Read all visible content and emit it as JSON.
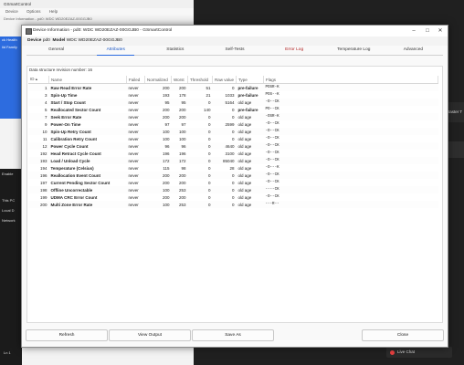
{
  "bg": {
    "title": "GSmartControl",
    "menu": [
      "Device",
      "Options",
      "Help"
    ],
    "sub1": "Device Information - pd0: WDC WD20EZAZ-00GGJB0",
    "sidebar": [
      "ck Health",
      "ild Family"
    ],
    "dark_items": [
      "Enable",
      "This PC",
      "Local D",
      "Network"
    ],
    "line": "Ln 1",
    "right_label": "Raster T",
    "live_chat": "Live Chat"
  },
  "dialog": {
    "title": "Device Information - pd0: WDC WD20EZAZ-00GGJB0 - GSmartControl",
    "device_label": "Device",
    "device_value": "pd0",
    "model_label": "Model",
    "model_value": "WDC WD20EZAZ-00GGJB0",
    "tabs": [
      {
        "label": "General"
      },
      {
        "label": "Attributes"
      },
      {
        "label": "Statistics"
      },
      {
        "label": "Self-Tests"
      },
      {
        "label": "Error Log"
      },
      {
        "label": "Temperature Log"
      },
      {
        "label": "Advanced"
      }
    ],
    "revision_text": "Data structure revision number: 16",
    "columns": [
      "ID",
      "Name",
      "Failed",
      "Normalized",
      "Worst",
      "Threshold",
      "Raw value",
      "Type",
      "Flags"
    ],
    "rows": [
      {
        "id": "1",
        "name": "Raw Read Error Rate",
        "failed": "never",
        "norm": "200",
        "worst": "200",
        "thr": "51",
        "raw": "0",
        "type": "pre-failure",
        "flags": "POSR-K"
      },
      {
        "id": "3",
        "name": "Spin-Up Time",
        "failed": "never",
        "norm": "193",
        "worst": "178",
        "thr": "21",
        "raw": "1033",
        "type": "pre-failure",
        "flags": "POS--K"
      },
      {
        "id": "4",
        "name": "Start / Stop Count",
        "failed": "never",
        "norm": "95",
        "worst": "95",
        "thr": "0",
        "raw": "5164",
        "type": "old age",
        "flags": "-O--CK"
      },
      {
        "id": "5",
        "name": "Reallocated Sector Count",
        "failed": "never",
        "norm": "200",
        "worst": "200",
        "thr": "140",
        "raw": "0",
        "type": "pre-failure",
        "flags": "PO--CK"
      },
      {
        "id": "7",
        "name": "Seek Error Rate",
        "failed": "never",
        "norm": "200",
        "worst": "200",
        "thr": "0",
        "raw": "0",
        "type": "old age",
        "flags": "-OSR-K"
      },
      {
        "id": "9",
        "name": "Power-On Time",
        "failed": "never",
        "norm": "97",
        "worst": "97",
        "thr": "0",
        "raw": "2599",
        "type": "old age",
        "flags": "-O--CK"
      },
      {
        "id": "10",
        "name": "Spin-Up Retry Count",
        "failed": "never",
        "norm": "100",
        "worst": "100",
        "thr": "0",
        "raw": "0",
        "type": "old age",
        "flags": "-O--CK"
      },
      {
        "id": "11",
        "name": "Calibration Retry Count",
        "failed": "never",
        "norm": "100",
        "worst": "100",
        "thr": "0",
        "raw": "0",
        "type": "old age",
        "flags": "-O--CK"
      },
      {
        "id": "12",
        "name": "Power Cycle Count",
        "failed": "never",
        "norm": "96",
        "worst": "96",
        "thr": "0",
        "raw": "4640",
        "type": "old age",
        "flags": "-O--CK"
      },
      {
        "id": "192",
        "name": "Head Retract Cycle Count",
        "failed": "never",
        "norm": "196",
        "worst": "196",
        "thr": "0",
        "raw": "3100",
        "type": "old age",
        "flags": "-O--CK"
      },
      {
        "id": "193",
        "name": "Load / Unload Cycle",
        "failed": "never",
        "norm": "172",
        "worst": "172",
        "thr": "0",
        "raw": "85040",
        "type": "old age",
        "flags": "-O--CK"
      },
      {
        "id": "194",
        "name": "Temperature (Celsius)",
        "failed": "never",
        "norm": "115",
        "worst": "98",
        "thr": "0",
        "raw": "28",
        "type": "old age",
        "flags": "-O---K"
      },
      {
        "id": "196",
        "name": "Reallocation Event Count",
        "failed": "never",
        "norm": "200",
        "worst": "200",
        "thr": "0",
        "raw": "0",
        "type": "old age",
        "flags": "-O--CK"
      },
      {
        "id": "197",
        "name": "Current Pending Sector Count",
        "failed": "never",
        "norm": "200",
        "worst": "200",
        "thr": "0",
        "raw": "0",
        "type": "old age",
        "flags": "-O--CK"
      },
      {
        "id": "198",
        "name": "Offline Uncorrectable",
        "failed": "never",
        "norm": "100",
        "worst": "253",
        "thr": "0",
        "raw": "0",
        "type": "old age",
        "flags": "----CK"
      },
      {
        "id": "199",
        "name": "UDMA CRC Error Count",
        "failed": "never",
        "norm": "200",
        "worst": "200",
        "thr": "0",
        "raw": "0",
        "type": "old age",
        "flags": "-O--CK"
      },
      {
        "id": "200",
        "name": "Multi Zone Error Rate",
        "failed": "never",
        "norm": "100",
        "worst": "253",
        "thr": "0",
        "raw": "0",
        "type": "old age",
        "flags": "---R--"
      }
    ],
    "buttons": {
      "refresh": "Refresh",
      "view_output": "View Output",
      "save_as": "Save As",
      "close": "Close"
    }
  }
}
